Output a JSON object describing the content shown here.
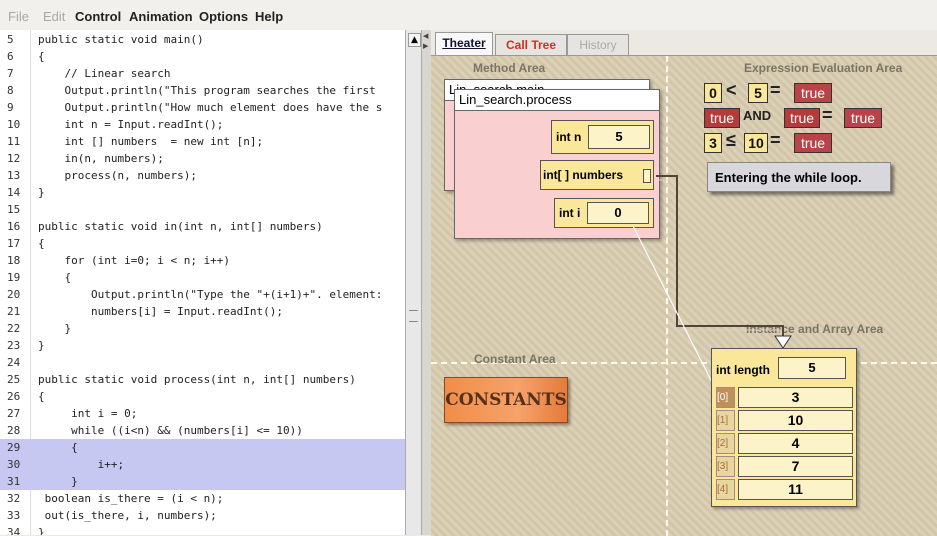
{
  "menu": {
    "file": "File",
    "edit": "Edit",
    "control": "Control",
    "animation": "Animation",
    "options": "Options",
    "help": "Help"
  },
  "code": {
    "lines": [
      {
        "n": "5",
        "t": "public static void main()"
      },
      {
        "n": "6",
        "t": "{"
      },
      {
        "n": "7",
        "t": "    // Linear search"
      },
      {
        "n": "8",
        "t": "    Output.println(\"This program searches the first"
      },
      {
        "n": "9",
        "t": "    Output.println(\"How much element does have the s"
      },
      {
        "n": "10",
        "t": "    int n = Input.readInt();"
      },
      {
        "n": "11",
        "t": "    int [] numbers  = new int [n];"
      },
      {
        "n": "12",
        "t": "    in(n, numbers);"
      },
      {
        "n": "13",
        "t": "    process(n, numbers);"
      },
      {
        "n": "14",
        "t": "}"
      },
      {
        "n": "15",
        "t": ""
      },
      {
        "n": "16",
        "t": "public static void in(int n, int[] numbers)"
      },
      {
        "n": "17",
        "t": "{"
      },
      {
        "n": "18",
        "t": "    for (int i=0; i < n; i++)"
      },
      {
        "n": "19",
        "t": "    {"
      },
      {
        "n": "20",
        "t": "        Output.println(\"Type the \"+(i+1)+\". element:"
      },
      {
        "n": "21",
        "t": "        numbers[i] = Input.readInt();"
      },
      {
        "n": "22",
        "t": "    }"
      },
      {
        "n": "23",
        "t": "}"
      },
      {
        "n": "24",
        "t": ""
      },
      {
        "n": "25",
        "t": "public static void process(int n, int[] numbers)"
      },
      {
        "n": "26",
        "t": "{"
      },
      {
        "n": "27",
        "t": "     int i = 0;"
      },
      {
        "n": "28",
        "t": "     while ((i<n) && (numbers[i] <= 10))"
      },
      {
        "n": "29",
        "t": "     {"
      },
      {
        "n": "30",
        "t": "         i++;"
      },
      {
        "n": "31",
        "t": "     }"
      },
      {
        "n": "32",
        "t": " boolean is_there = (i < n);"
      },
      {
        "n": "33",
        "t": " out(is_there, i, numbers);"
      },
      {
        "n": "34",
        "t": "}"
      }
    ],
    "highlighted": [
      "29",
      "30",
      "31"
    ]
  },
  "tabs": {
    "theater": "Theater",
    "call_tree": "Call Tree",
    "history": "History"
  },
  "areas": {
    "method": "Method Area",
    "expression": "Expression Evaluation Area",
    "constant": "Constant Area",
    "instance": "Instance and Array Area"
  },
  "frames": {
    "back_title": "Lin_search.main",
    "front_title": "Lin_search.process",
    "vars": {
      "n_label": "int n",
      "n_value": "5",
      "numbers_label": "int[ ] numbers",
      "i_label": "int i",
      "i_value": "0"
    }
  },
  "expressions": {
    "row1": {
      "left": "0",
      "op": "<",
      "right": "5",
      "eq": "=",
      "result": "true"
    },
    "row2": {
      "left": "true",
      "op": "AND",
      "right": "true",
      "eq": "=",
      "result": "true"
    },
    "row3": {
      "left": "3",
      "op": "≤",
      "right": "10",
      "eq": "=",
      "result": "true"
    }
  },
  "message": "Entering the while loop.",
  "constants": "CONSTANTS",
  "array": {
    "length_label": "int length",
    "length_value": "5",
    "cells": [
      {
        "idx": "[0]",
        "val": "3"
      },
      {
        "idx": "[1]",
        "val": "10"
      },
      {
        "idx": "[2]",
        "val": "4"
      },
      {
        "idx": "[3]",
        "val": "7"
      },
      {
        "idx": "[4]",
        "val": "11"
      }
    ]
  },
  "colors": {
    "frame": "#f9cfcf",
    "var": "#fbe79a",
    "highlight": "#c6c8f2",
    "true_box": "#b53a3a",
    "constants": "#f08e48"
  }
}
